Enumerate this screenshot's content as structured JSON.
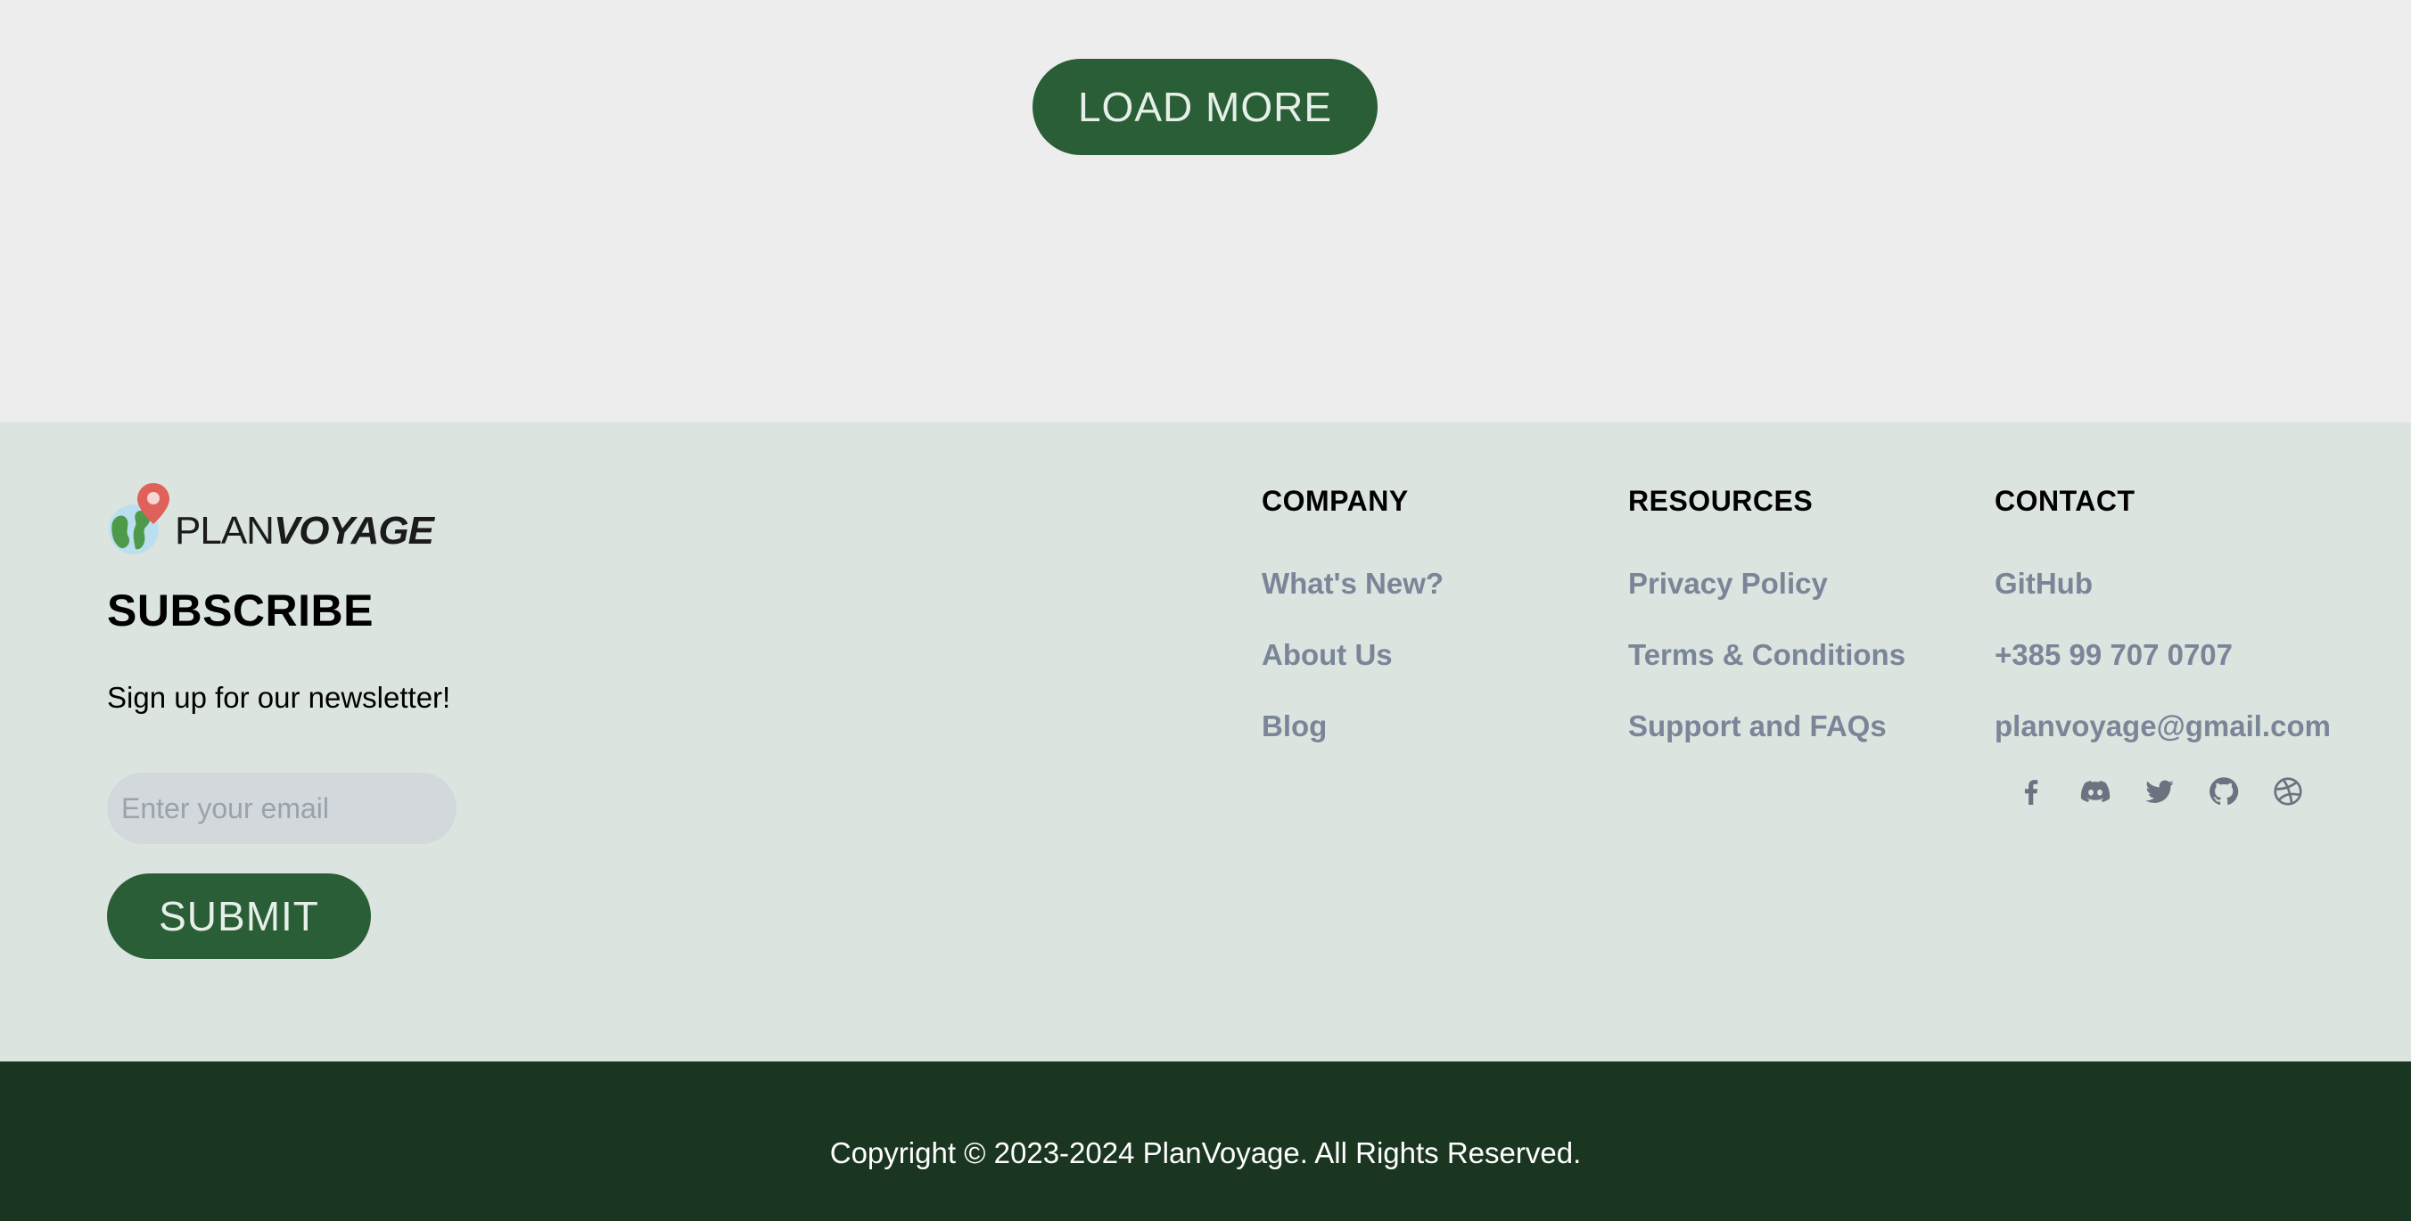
{
  "main": {
    "load_more_label": "LOAD MORE"
  },
  "footer": {
    "logo": {
      "text_plain": "PLAN",
      "text_bold": "VOYAGE",
      "icon": "globe-pin-icon"
    },
    "subscribe": {
      "title": "SUBSCRIBE",
      "text": "Sign up for our newsletter!",
      "email_placeholder": "Enter your email",
      "email_value": "",
      "submit_label": "SUBMIT"
    },
    "columns": {
      "company": {
        "heading": "COMPANY",
        "links": [
          "What's New?",
          "About Us",
          "Blog"
        ]
      },
      "resources": {
        "heading": "RESOURCES",
        "links": [
          "Privacy Policy",
          "Terms & Conditions",
          "Support and FAQs"
        ]
      },
      "contact": {
        "heading": "CONTACT",
        "links": [
          "GitHub",
          "+385 99 707 0707",
          "planvoyage@gmail.com"
        ]
      }
    },
    "socials": [
      "facebook-icon",
      "discord-icon",
      "twitter-icon",
      "github-icon",
      "dribbble-icon"
    ],
    "copyright": "Copyright © 2023-2024 PlanVoyage. All Rights Reserved."
  },
  "colors": {
    "brand_green": "#2a5e36",
    "footer_bg": "#dbe4de",
    "bottom_bar_bg": "#1a3520",
    "link_gray": "#7a8598",
    "page_bg": "#ededed"
  }
}
